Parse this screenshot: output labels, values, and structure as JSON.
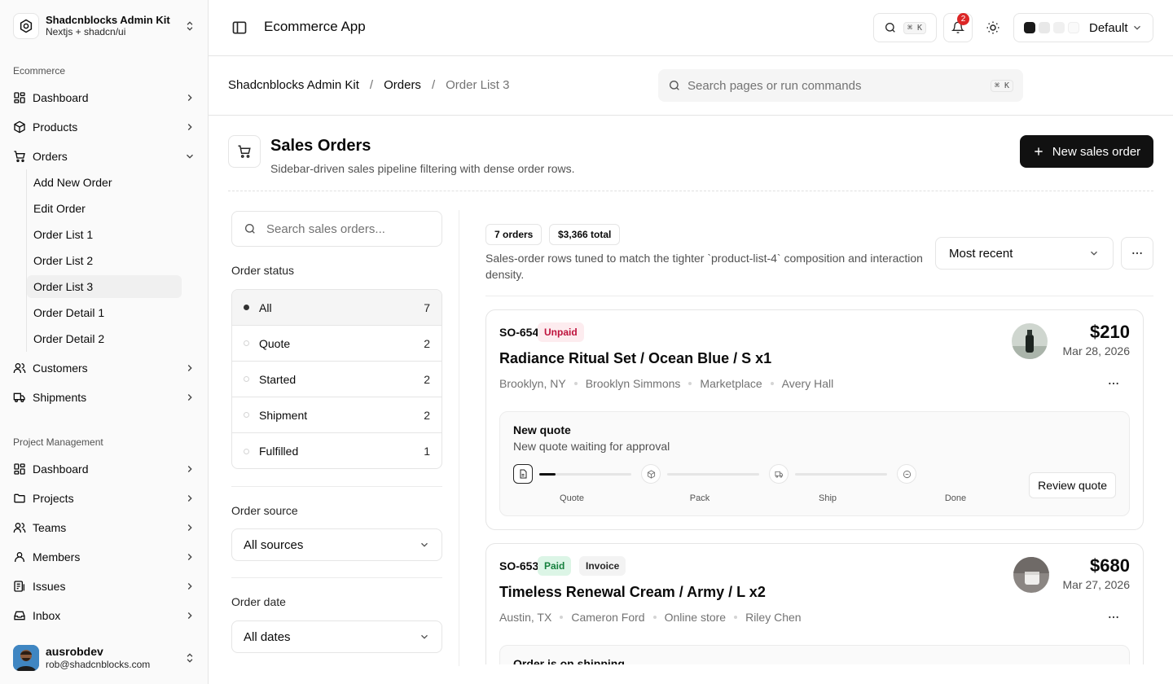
{
  "sidebar": {
    "team": {
      "name": "Shadcnblocks Admin Kit",
      "sub": "Nextjs + shadcn/ui"
    },
    "groups": {
      "ecommerce": "Ecommerce",
      "project": "Project Management"
    },
    "ecommerce_items": [
      {
        "label": "Dashboard",
        "icon": "dashboard-icon"
      },
      {
        "label": "Products",
        "icon": "box-icon"
      },
      {
        "label": "Orders",
        "icon": "cart-icon"
      },
      {
        "label": "Customers",
        "icon": "users-icon"
      },
      {
        "label": "Shipments",
        "icon": "truck-icon"
      }
    ],
    "order_subitems": [
      "Add New Order",
      "Edit Order",
      "Order List 1",
      "Order List 2",
      "Order List 3",
      "Order Detail 1",
      "Order Detail 2"
    ],
    "project_items": [
      {
        "label": "Dashboard",
        "icon": "dashboard-icon"
      },
      {
        "label": "Projects",
        "icon": "folder-icon"
      },
      {
        "label": "Teams",
        "icon": "users-icon"
      },
      {
        "label": "Members",
        "icon": "user-icon"
      },
      {
        "label": "Issues",
        "icon": "list-icon"
      },
      {
        "label": "Inbox",
        "icon": "inbox-icon"
      }
    ],
    "user": {
      "name": "ausrobdev",
      "email": "rob@shadcnblocks.com"
    }
  },
  "topbar": {
    "title": "Ecommerce App",
    "search_kbd": "⌘ K",
    "notification_count": "2",
    "theme_label": "Default",
    "swatch_colors": [
      "#1a1a1a",
      "#e8e8e8",
      "#f0f0f0",
      "#fafafa"
    ]
  },
  "breadcrumb": {
    "root": "Shadcnblocks Admin Kit",
    "mid": "Orders",
    "current": "Order List 3"
  },
  "command_search": {
    "placeholder": "Search pages or run commands",
    "kbd": "⌘ K"
  },
  "header": {
    "title": "Sales Orders",
    "description": "Sidebar-driven sales pipeline filtering with dense order rows.",
    "new_button": "New sales order"
  },
  "filters": {
    "search_placeholder": "Search sales orders...",
    "status_label": "Order status",
    "statuses": [
      {
        "label": "All",
        "count": "7"
      },
      {
        "label": "Quote",
        "count": "2"
      },
      {
        "label": "Started",
        "count": "2"
      },
      {
        "label": "Shipment",
        "count": "2"
      },
      {
        "label": "Fulfilled",
        "count": "1"
      }
    ],
    "source_label": "Order source",
    "source_value": "All sources",
    "date_label": "Order date",
    "date_value": "All dates"
  },
  "list": {
    "count_pill": "7 orders",
    "total_pill": "$3,366 total",
    "description": "Sales-order rows tuned to match the tighter `product-list-4` composition and interaction density.",
    "sort_value": "Most recent"
  },
  "orders": [
    {
      "id": "SO-654",
      "badges": [
        "Unpaid"
      ],
      "title": "Radiance Ritual Set / Ocean Blue / S x1",
      "meta": [
        "Brooklyn, NY",
        "Brooklyn Simmons",
        "Marketplace",
        "Avery Hall"
      ],
      "price": "$210",
      "date": "Mar 28, 2026",
      "progress_title": "New quote",
      "progress_sub": "New quote waiting for approval",
      "steps": [
        "Quote",
        "Pack",
        "Ship",
        "Done"
      ],
      "first_track_progress": 0.18,
      "action": "Review quote"
    },
    {
      "id": "SO-653",
      "badges": [
        "Paid",
        "Invoice"
      ],
      "title": "Timeless Renewal Cream / Army / L x2",
      "meta": [
        "Austin, TX",
        "Cameron Ford",
        "Online store",
        "Riley Chen"
      ],
      "price": "$680",
      "date": "Mar 27, 2026",
      "progress_title": "Order is on shipping"
    }
  ]
}
